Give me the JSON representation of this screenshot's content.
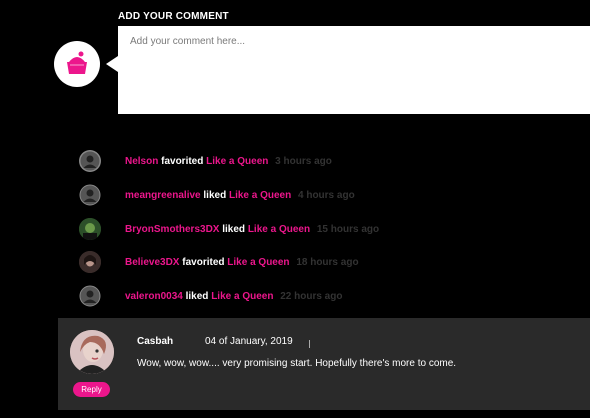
{
  "add_comment": {
    "title": "ADD YOUR COMMENT",
    "placeholder": "Add your comment here...",
    "avatar_icon": "cupcake-avatar-icon",
    "accent": "#ec168c"
  },
  "activity": [
    {
      "user": "Nelson",
      "action": "favorited",
      "item": "Like a Queen",
      "time": "3 hours ago",
      "avatar": "default-user-icon"
    },
    {
      "user": "meangreenalive",
      "action": "liked",
      "item": "Like a Queen",
      "time": "4 hours ago",
      "avatar": "default-user-icon"
    },
    {
      "user": "BryonSmothers3DX",
      "action": "liked",
      "item": "Like a Queen",
      "time": "15 hours ago",
      "avatar": "photo-avatar"
    },
    {
      "user": "Believe3DX",
      "action": "favorited",
      "item": "Like a Queen",
      "time": "18 hours ago",
      "avatar": "photo-avatar"
    },
    {
      "user": "valeron0034",
      "action": "liked",
      "item": "Like a Queen",
      "time": "22 hours ago",
      "avatar": "default-user-icon"
    }
  ],
  "comment": {
    "author": "Casbah",
    "date": "04 of January, 2019",
    "text": "Wow, wow, wow.... very promising start. Hopefully there's more to come.",
    "reply_label": "Reply"
  }
}
